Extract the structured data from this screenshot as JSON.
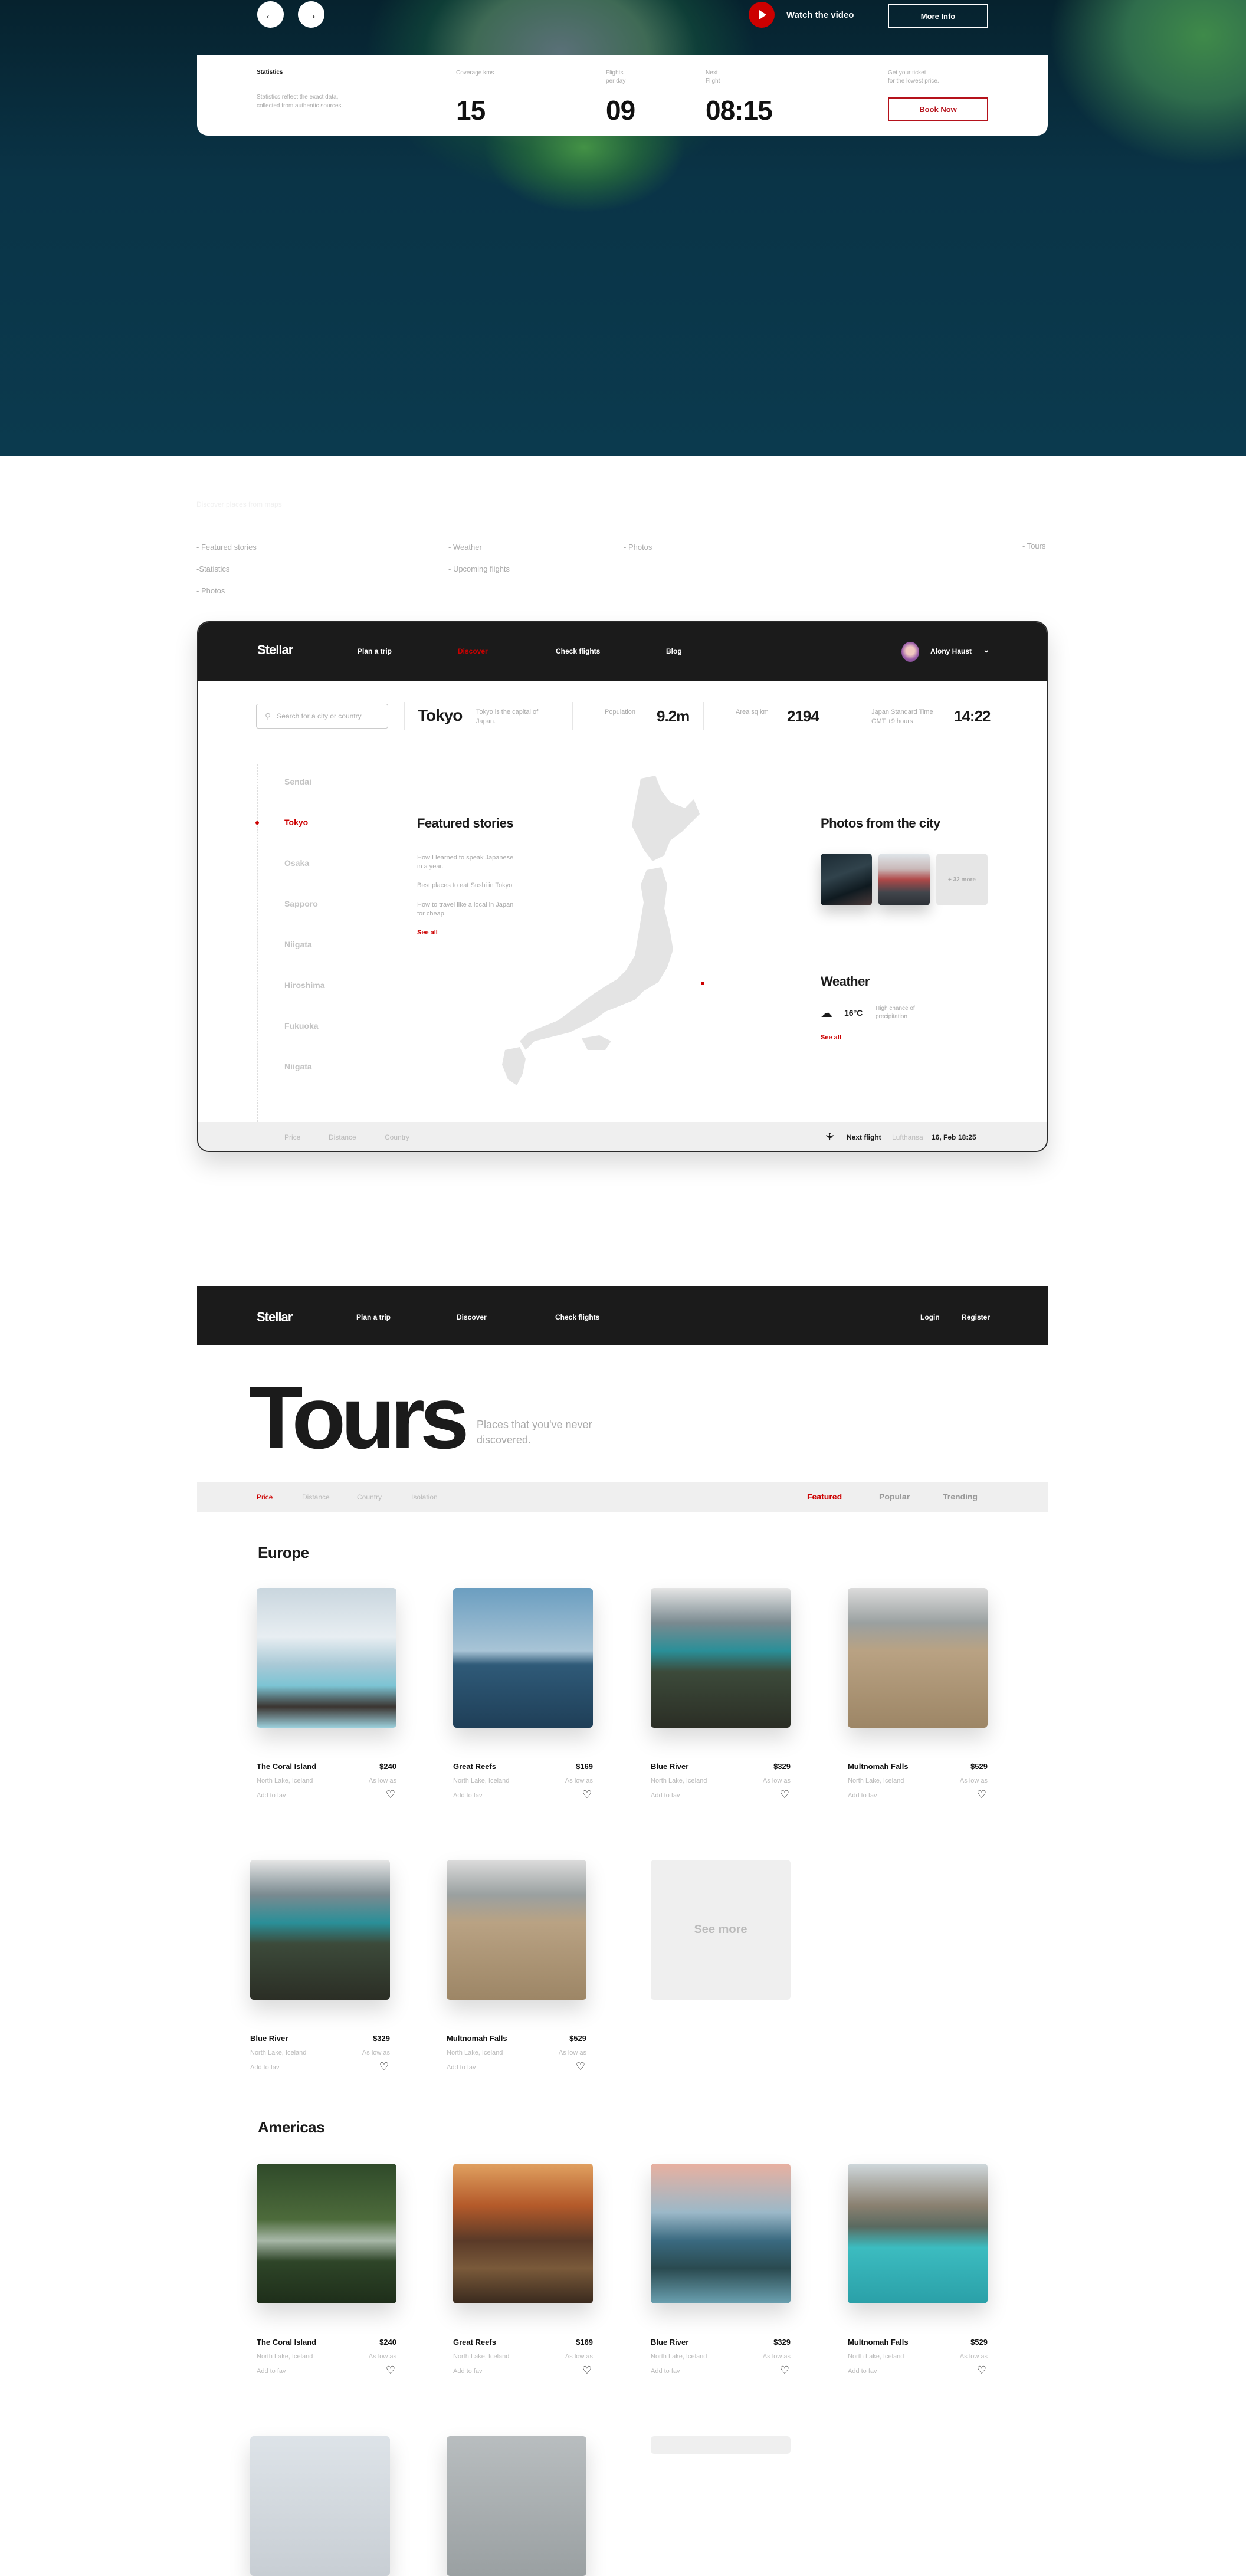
{
  "hero": {
    "prev_icon": "arrow-left-icon",
    "next_icon": "arrow-right-icon",
    "watch_video": "Watch the video",
    "more_info": "More Info",
    "stats_title": "Statistics",
    "stats_desc": "Statistics reflect the exact data, collected from authentic sources.",
    "coverage_label": "Coverage kms",
    "coverage_value": "15",
    "flights_label_1": "Flights",
    "flights_label_2": "per day",
    "flights_value": "09",
    "next_label_1": "Next",
    "next_label_2": "Flight",
    "next_value": "08:15",
    "ticket_label_1": "Get your ticket",
    "ticket_label_2": "for the lowest price.",
    "book_now": "Book Now"
  },
  "sitemap": {
    "heading": "Discover places from maps",
    "col1": [
      "- Featured stories",
      "-Statistics",
      "- Photos"
    ],
    "col2": [
      "- Weather",
      "- Upcoming flights"
    ],
    "col3": [
      "- Photos"
    ],
    "col4": [
      "- Tours"
    ]
  },
  "discover": {
    "logo": "Stellar",
    "nav": [
      "Plan a trip",
      "Discover",
      "Check flights",
      "Blog"
    ],
    "active_nav": "Discover",
    "user_name": "Alony Haust",
    "search_placeholder": "Search for a city or country",
    "city": "Tokyo",
    "city_desc": "Tokyo is the capital of Japan.",
    "population_label": "Population",
    "population_value": "9.2m",
    "area_label": "Area sq km",
    "area_value": "2194",
    "tz_label_1": "Japan Standard Time",
    "tz_label_2": "GMT +9 hours",
    "time_value": "14:22",
    "cities": [
      "Sendai",
      "Tokyo",
      "Osaka",
      "Sapporo",
      "Niigata",
      "Hiroshima",
      "Fukuoka",
      "Niigata"
    ],
    "active_city": "Tokyo",
    "featured_title": "Featured stories",
    "stories": [
      "How I learned to speak Japanese in a year.",
      "Best places to eat Sushi in Tokyo",
      "How to travel like a local in Japan for cheap."
    ],
    "see_all": "See all",
    "photos_title": "Photos from the city",
    "photos_more": "+ 32 more",
    "weather_title": "Weather",
    "weather_icon": "cloud-rain-icon",
    "temperature": "16°C",
    "weather_desc": "High chance of precipitation",
    "weather_see_all": "See all",
    "footer_filters": [
      "Price",
      "Distance",
      "Country"
    ],
    "next_flight_label": "Next flight",
    "airline": "Lufthansa",
    "flight_date": "16, Feb",
    "flight_time": "18:25"
  },
  "tours": {
    "logo": "Stellar",
    "nav": [
      "Plan a trip",
      "Discover",
      "Check flights"
    ],
    "login": "Login",
    "register": "Register",
    "title": "Tours",
    "subtitle": "Places that you've never discovered.",
    "filters": [
      "Price",
      "Distance",
      "Country",
      "Isolation"
    ],
    "active_filter": "Price",
    "tabs": [
      "Featured",
      "Popular",
      "Trending"
    ],
    "active_tab": "Featured",
    "see_more": "See more",
    "sections": [
      {
        "title": "Europe",
        "rows": [
          [
            {
              "name": "The Coral Island",
              "price": "$240",
              "location": "North Lake, Iceland",
              "note": "As low as",
              "fav": "Add to fav"
            },
            {
              "name": "Great Reefs",
              "price": "$169",
              "location": "North Lake, Iceland",
              "note": "As low as",
              "fav": "Add to fav"
            },
            {
              "name": "Blue River",
              "price": "$329",
              "location": "North Lake, Iceland",
              "note": "As low as",
              "fav": "Add to fav"
            },
            {
              "name": "Multnomah Falls",
              "price": "$529",
              "location": "North Lake, Iceland",
              "note": "As low as",
              "fav": "Add to fav"
            }
          ],
          [
            {
              "name": "Blue River",
              "price": "$329",
              "location": "North Lake, Iceland",
              "note": "As low as",
              "fav": "Add to fav"
            },
            {
              "name": "Multnomah Falls",
              "price": "$529",
              "location": "North Lake, Iceland",
              "note": "As low as",
              "fav": "Add to fav"
            }
          ]
        ]
      },
      {
        "title": "Americas",
        "rows": [
          [
            {
              "name": "The Coral Island",
              "price": "$240",
              "location": "North Lake, Iceland",
              "note": "As low as",
              "fav": "Add to fav"
            },
            {
              "name": "Great Reefs",
              "price": "$169",
              "location": "North Lake, Iceland",
              "note": "As low as",
              "fav": "Add to fav"
            },
            {
              "name": "Blue River",
              "price": "$329",
              "location": "North Lake, Iceland",
              "note": "As low as",
              "fav": "Add to fav"
            },
            {
              "name": "Multnomah Falls",
              "price": "$529",
              "location": "North Lake, Iceland",
              "note": "As low as",
              "fav": "Add to fav"
            }
          ]
        ]
      }
    ]
  },
  "colors": {
    "accent": "#cc0000",
    "dark": "#1b1b1b",
    "muted": "#aaaaaa",
    "panel": "#efefef"
  }
}
